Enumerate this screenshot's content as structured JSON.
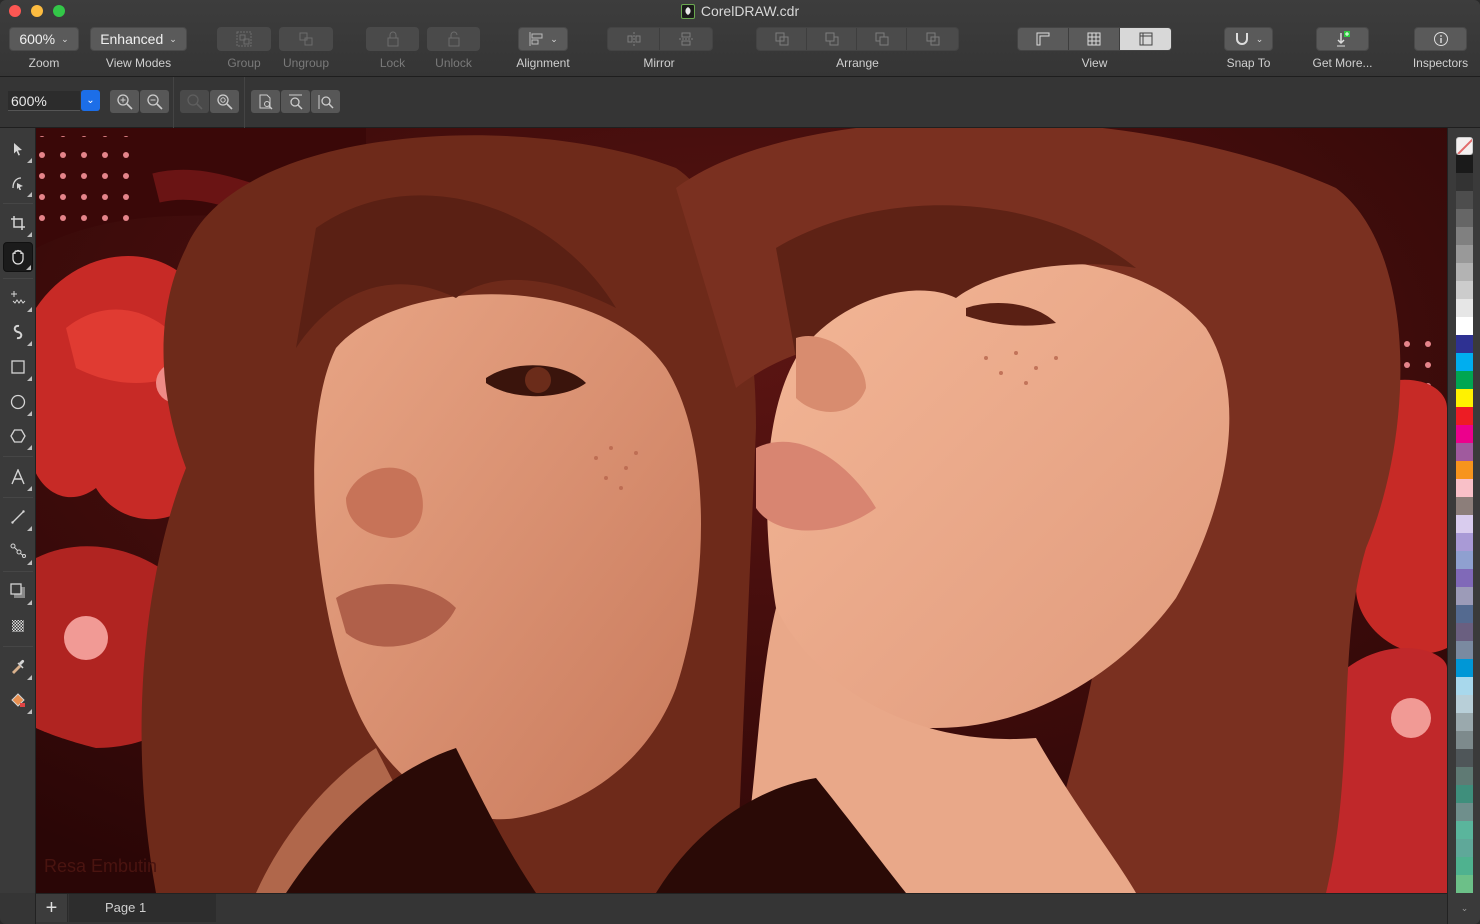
{
  "window": {
    "title": "CorelDRAW.cdr"
  },
  "toolbar": {
    "zoom": {
      "value": "600%",
      "label": "Zoom"
    },
    "view_modes": {
      "value": "Enhanced",
      "label": "View Modes"
    },
    "group": {
      "label": "Group",
      "icon": "group-icon",
      "enabled": false
    },
    "ungroup": {
      "label": "Ungroup",
      "icon": "ungroup-icon",
      "enabled": false
    },
    "lock": {
      "label": "Lock",
      "icon": "lock-icon",
      "enabled": false
    },
    "unlock": {
      "label": "Unlock",
      "icon": "unlock-icon",
      "enabled": false
    },
    "alignment": {
      "label": "Alignment",
      "icon": "align-left-icon"
    },
    "mirror": {
      "label": "Mirror",
      "buttons": [
        "mirror-horizontal-icon",
        "mirror-vertical-icon"
      ]
    },
    "arrange": {
      "label": "Arrange",
      "buttons": [
        "to-front-icon",
        "forward-one-icon",
        "back-one-icon",
        "to-back-icon"
      ]
    },
    "view": {
      "label": "View",
      "buttons": [
        "rulers-icon",
        "grid-icon",
        "guidelines-icon"
      ],
      "active_index": 2
    },
    "snap_to": {
      "label": "Snap To",
      "icon": "magnet-icon"
    },
    "get_more": {
      "label": "Get More...",
      "icon": "download-icon"
    },
    "inspectors": {
      "label": "Inspectors",
      "icon": "info-icon"
    }
  },
  "propbar": {
    "zoom_value": "600%",
    "buttons": [
      {
        "name": "zoom-in",
        "icon": "zoom-in-icon",
        "enabled": true
      },
      {
        "name": "zoom-out",
        "icon": "zoom-out-icon",
        "enabled": true
      },
      {
        "name": "zoom-to-selected",
        "icon": "zoom-selected-icon",
        "enabled": false
      },
      {
        "name": "zoom-to-all-objects",
        "icon": "zoom-all-icon",
        "enabled": true
      },
      {
        "name": "zoom-to-page",
        "icon": "zoom-page-icon",
        "enabled": true
      },
      {
        "name": "zoom-to-page-width",
        "icon": "zoom-width-icon",
        "enabled": true
      },
      {
        "name": "zoom-to-page-height",
        "icon": "zoom-height-icon",
        "enabled": true
      }
    ]
  },
  "toolbox": {
    "tools": [
      {
        "name": "pick-tool",
        "icon": "pointer-icon"
      },
      {
        "name": "shape-tool",
        "icon": "shape-icon"
      },
      {
        "name": "crop-tool",
        "icon": "crop-icon"
      },
      {
        "name": "pan-tool",
        "icon": "hand-icon",
        "active": true
      },
      {
        "name": "freehand-tool",
        "icon": "freehand-icon"
      },
      {
        "name": "artistic-media-tool",
        "icon": "artistic-media-icon"
      },
      {
        "name": "rectangle-tool",
        "icon": "rectangle-icon"
      },
      {
        "name": "ellipse-tool",
        "icon": "ellipse-icon"
      },
      {
        "name": "polygon-tool",
        "icon": "polygon-icon"
      },
      {
        "name": "text-tool",
        "icon": "text-icon"
      },
      {
        "name": "parallel-dimension-tool",
        "icon": "line-icon"
      },
      {
        "name": "connector-tool",
        "icon": "connector-icon"
      },
      {
        "name": "drop-shadow-tool",
        "icon": "shadow-icon"
      },
      {
        "name": "transparency-tool",
        "icon": "transparency-icon"
      },
      {
        "name": "eyedropper-tool",
        "icon": "eyedropper-icon"
      },
      {
        "name": "interactive-fill-tool",
        "icon": "fill-icon"
      }
    ]
  },
  "canvas": {
    "artwork_credit": "Resa Embutin"
  },
  "palette": {
    "colors": [
      "none",
      "#1a1a1a",
      "#333333",
      "#4d4d4d",
      "#666666",
      "#808080",
      "#999999",
      "#b3b3b3",
      "#cccccc",
      "#e6e6e6",
      "#ffffff",
      "#2e3192",
      "#00aeef",
      "#00a651",
      "#fff200",
      "#ed1c24",
      "#ec008c",
      "#a05a9e",
      "#f7941d",
      "#f9c0c8",
      "#8c7e7a",
      "#d9ccee",
      "#a99ad6",
      "#8fa0d0",
      "#8069b8",
      "#9c9bb8",
      "#546a90",
      "#6a5f80",
      "#7a8aa0",
      "#0097d6",
      "#a8d8ec",
      "#b8cfd8",
      "#9aa9ad",
      "#7d8a8c",
      "#4f5659",
      "#5f7a74",
      "#3f8f7c",
      "#6f8f8c",
      "#5ab59c",
      "#5fa899",
      "#4fb28f",
      "#6cc088"
    ]
  },
  "statusbar": {
    "add_page": "+",
    "page_tab": "Page 1"
  }
}
